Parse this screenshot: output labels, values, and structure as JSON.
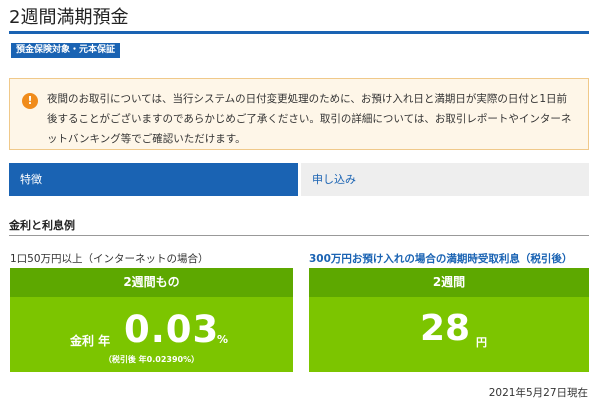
{
  "page": {
    "title": "2週間満期預金",
    "badge": "預金保険対象・元本保証"
  },
  "notice": {
    "icon": "exclamation-icon",
    "text": "夜間のお取引については、当行システムの日付変更処理のために、お預け入れ日と満期日が実際の日付と1日前後することがございますのであらかじめご了承ください。取引の詳細については、お取引レポートやインターネットバンキング等でご確認いただけます。"
  },
  "tabs": [
    {
      "label": "特徴",
      "active": true
    },
    {
      "label": "申し込み",
      "active": false
    }
  ],
  "section": {
    "heading": "金利と利息例"
  },
  "rate_card": {
    "caption": "1口50万円以上（インターネットの場合）",
    "header": "2週間もの",
    "prefix": "金利 年",
    "value": "0.03",
    "unit": "%",
    "note": "（税引後 年0.02390%）"
  },
  "interest_card": {
    "caption": "300万円お預け入れの場合の満期時受取利息（税引後）",
    "header": "2週間",
    "value": "28",
    "unit": "円"
  },
  "as_of": "2021年5月27日現在",
  "colors": {
    "brand_blue": "#1a63b3",
    "card_green": "#7cc500",
    "card_header_green": "#5da800",
    "notice_bg": "#fef6e8",
    "notice_icon": "#f08c1c"
  }
}
